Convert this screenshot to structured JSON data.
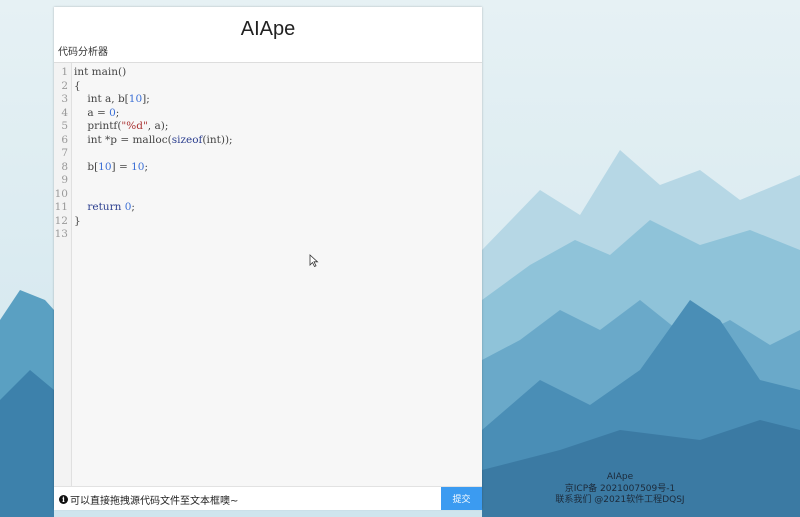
{
  "app": {
    "title": "AIApe",
    "subtitle": "代码分析器"
  },
  "editor": {
    "line_numbers": [
      "1",
      "2",
      "3",
      "4",
      "5",
      "6",
      "7",
      "8",
      "9",
      "10",
      "11",
      "12",
      "13"
    ],
    "lines": [
      [
        {
          "t": "int main()",
          "c": ""
        }
      ],
      [
        {
          "t": "{",
          "c": ""
        }
      ],
      [
        {
          "t": "    int a, b[",
          "c": ""
        },
        {
          "t": "10",
          "c": "num"
        },
        {
          "t": "];",
          "c": ""
        }
      ],
      [
        {
          "t": "    a = ",
          "c": ""
        },
        {
          "t": "0",
          "c": "num"
        },
        {
          "t": ";",
          "c": ""
        }
      ],
      [
        {
          "t": "    printf(",
          "c": ""
        },
        {
          "t": "\"%d\"",
          "c": "str"
        },
        {
          "t": ", a);",
          "c": ""
        }
      ],
      [
        {
          "t": "    int *p = malloc(",
          "c": ""
        },
        {
          "t": "sizeof",
          "c": "kw"
        },
        {
          "t": "(int));",
          "c": ""
        }
      ],
      [
        {
          "t": "",
          "c": ""
        }
      ],
      [
        {
          "t": "    b[",
          "c": ""
        },
        {
          "t": "10",
          "c": "num"
        },
        {
          "t": "] = ",
          "c": ""
        },
        {
          "t": "10",
          "c": "num"
        },
        {
          "t": ";",
          "c": ""
        }
      ],
      [
        {
          "t": "",
          "c": ""
        }
      ],
      [
        {
          "t": "",
          "c": ""
        }
      ],
      [
        {
          "t": "    ",
          "c": ""
        },
        {
          "t": "return",
          "c": "kw"
        },
        {
          "t": " ",
          "c": ""
        },
        {
          "t": "0",
          "c": "num"
        },
        {
          "t": ";",
          "c": ""
        }
      ],
      [
        {
          "t": "}",
          "c": ""
        }
      ],
      [
        {
          "t": "",
          "c": ""
        }
      ]
    ]
  },
  "bottom_bar": {
    "hint_icon": "info-icon",
    "hint_text": "可以直接拖拽源代码文件至文本框噢~",
    "submit_label": "提交",
    "submit_color": "#3b9bf1"
  },
  "footer": {
    "name": "AIApe",
    "icp": "京ICP备 2021007509号-1",
    "contact": "联系我们 @2021软件工程DQSJ"
  }
}
